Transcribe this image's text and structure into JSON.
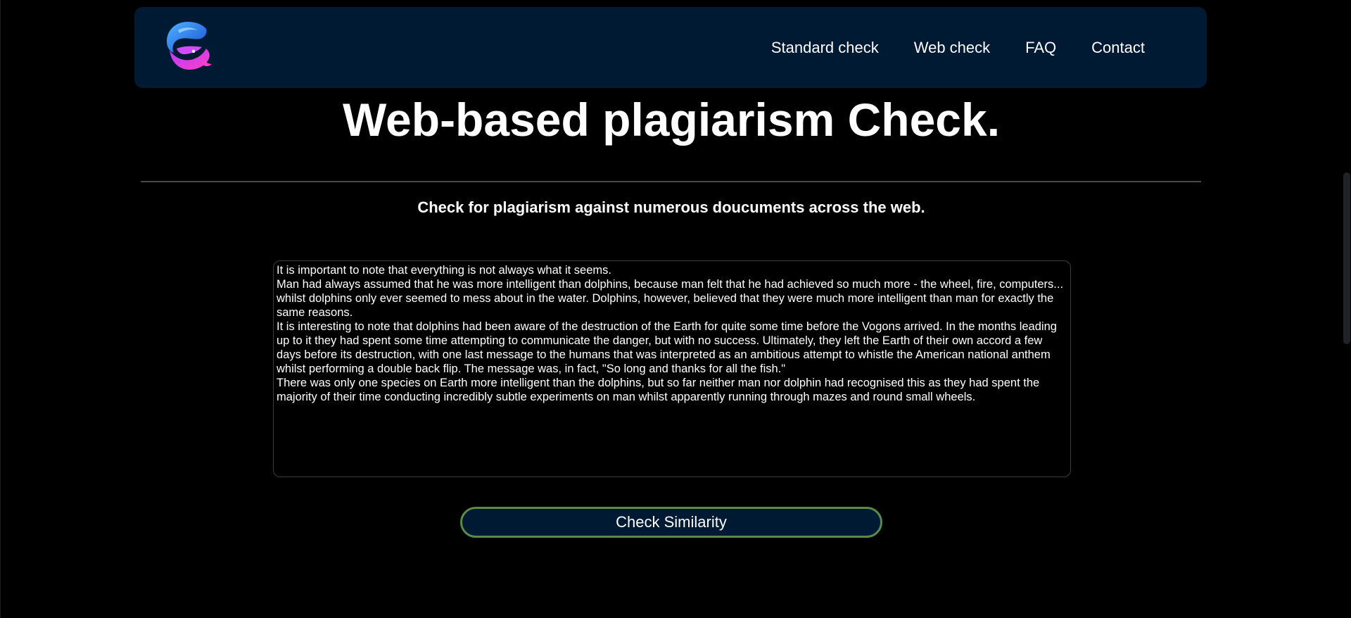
{
  "nav": {
    "links": [
      {
        "label": "Standard check"
      },
      {
        "label": "Web check"
      },
      {
        "label": "FAQ"
      },
      {
        "label": "Contact"
      }
    ]
  },
  "hero": {
    "title": "Web-based plagiarism Check.",
    "subtitle": "Check for plagiarism against numerous doucuments across the web."
  },
  "input": {
    "text": "It is important to note that everything is not always what it seems.\nMan had always assumed that he was more intelligent than dolphins, because man felt that he had achieved so much more - the wheel, fire, computers... whilst dolphins only ever seemed to mess about in the water. Dolphins, however, believed that they were much more intelligent than man for exactly the same reasons.\nIt is interesting to note that dolphins had been aware of the destruction of the Earth for quite some time before the Vogons arrived. In the months leading up to it they had spent some time attempting to communicate the danger, but with no success. Ultimately, they left the Earth of their own accord a few days before its destruction, with one last message to the humans that was interpreted as an ambitious attempt to whistle the American national anthem whilst performing a double back flip. The message was, in fact, \"So long and thanks for all the fish.\"\nThere was only one species on Earth more intelligent than the dolphins, but so far neither man nor dolphin had recognised this as they had spent the majority of their time conducting incredibly subtle experiments on man whilst apparently running through mazes and round small wheels."
  },
  "actions": {
    "check_label": "Check Similarity"
  },
  "icons": {
    "logo": "whale-logo-icon"
  },
  "colors": {
    "background": "#000000",
    "navbar": "#001a33",
    "button_border": "#5a8a4a",
    "divider": "#4a4a4a"
  }
}
